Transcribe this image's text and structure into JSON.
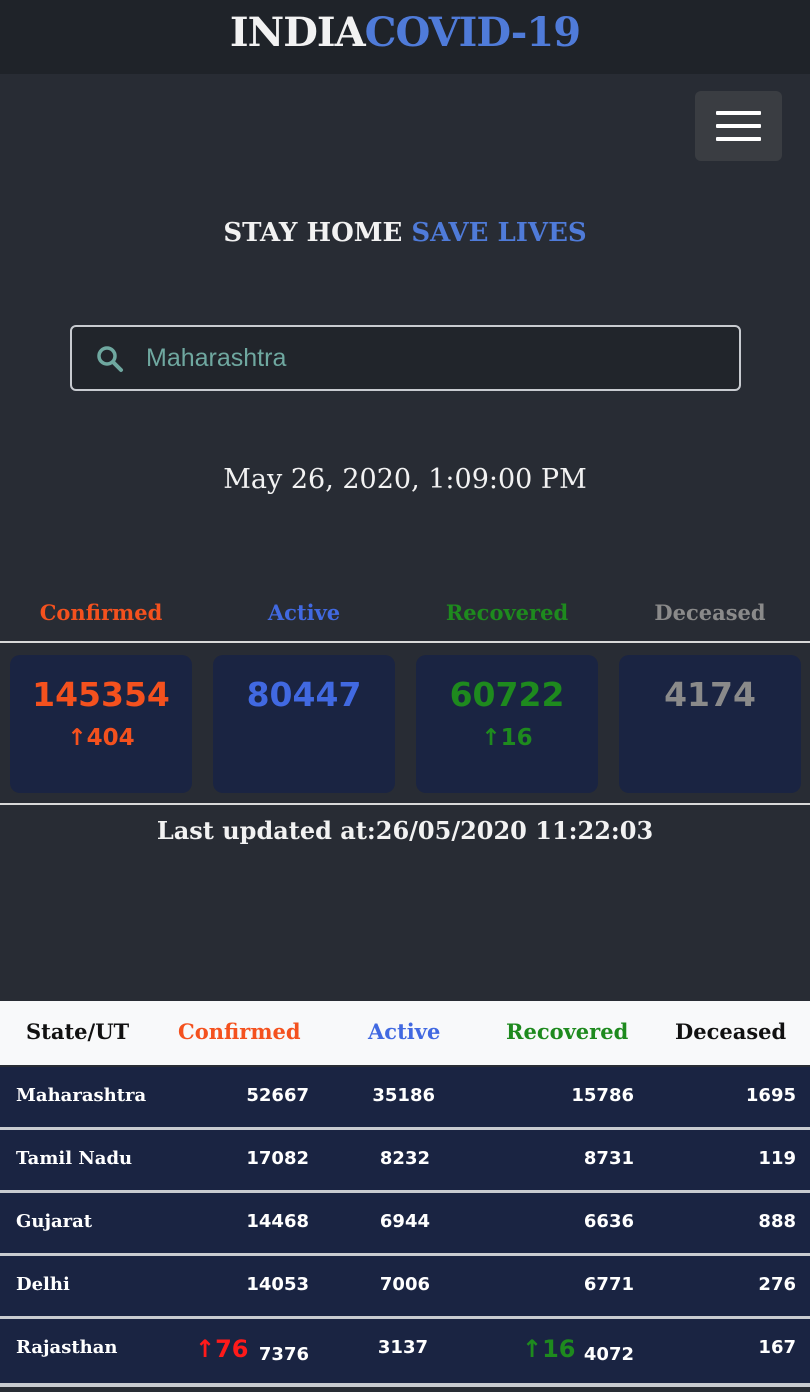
{
  "header": {
    "brand_white": "INDIA",
    "brand_blue": "COVID-19"
  },
  "tagline": {
    "white": "STAY HOME ",
    "blue": "SAVE LIVES"
  },
  "search": {
    "value": "Maharashtra",
    "placeholder": "Maharashtra"
  },
  "date": "May 26, 2020, 1:09:00 PM",
  "summary": {
    "labels": {
      "confirmed": "Confirmed",
      "active": "Active",
      "recovered": "Recovered",
      "deceased": "Deceased"
    },
    "confirmed": {
      "value": "145354",
      "delta": "404"
    },
    "active": {
      "value": "80447"
    },
    "recovered": {
      "value": "60722",
      "delta": "16"
    },
    "deceased": {
      "value": "4174"
    }
  },
  "last_updated": "Last updated at:26/05/2020 11:22:03",
  "table": {
    "headers": {
      "state": "State/UT",
      "confirmed": "Confirmed",
      "active": "Active",
      "recovered": "Recovered",
      "deceased": "Deceased"
    },
    "rows": [
      {
        "state": "Maharashtra",
        "confirmed": "52667",
        "active": "35186",
        "recovered": "15786",
        "deceased": "1695"
      },
      {
        "state": "Tamil Nadu",
        "confirmed": "17082",
        "active": "8232",
        "recovered": "8731",
        "deceased": "119"
      },
      {
        "state": "Gujarat",
        "confirmed": "14468",
        "active": "6944",
        "recovered": "6636",
        "deceased": "888"
      },
      {
        "state": "Delhi",
        "confirmed": "14053",
        "active": "7006",
        "recovered": "6771",
        "deceased": "276"
      },
      {
        "state": "Rajasthan",
        "confirmed": "7376",
        "confirmed_delta": "76",
        "active": "3137",
        "recovered": "4072",
        "recovered_delta": "16",
        "deceased": "167"
      }
    ]
  },
  "colors": {
    "confirmed": "#f4511e",
    "active": "#4169e1",
    "recovered": "#1e8a1e",
    "deceased": "#8a8a8a",
    "brand_blue": "#4f7bd9"
  },
  "icons": {
    "menu": "hamburger-icon",
    "search": "search-icon",
    "up": "arrow-up-icon"
  }
}
